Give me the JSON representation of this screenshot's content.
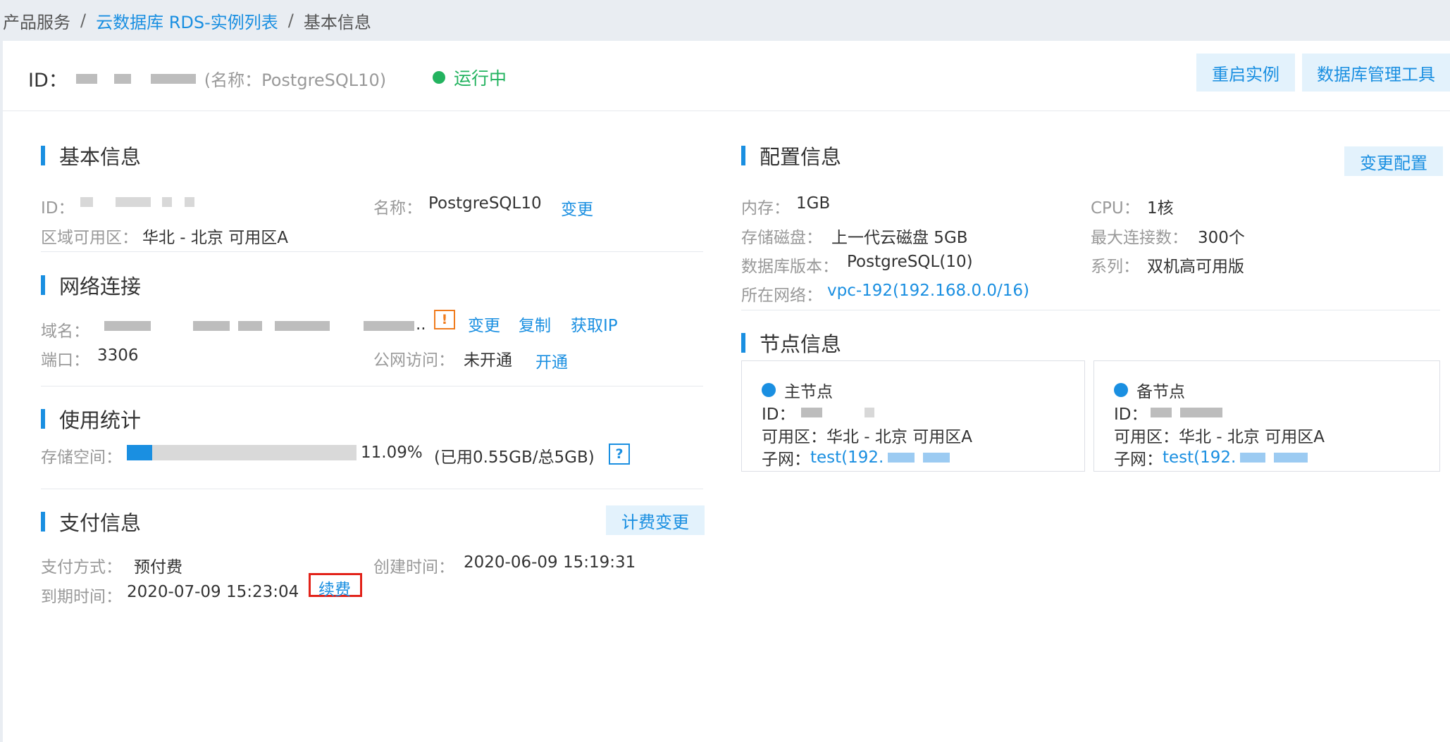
{
  "breadcrumb": {
    "items": [
      "产品服务",
      "云数据库 RDS-实例列表",
      "基本信息"
    ],
    "separator": "/"
  },
  "header": {
    "id_label": "ID：",
    "name_text": "(名称：PostgreSQL10)",
    "status_text": "运行中",
    "status_color": "#23b35f",
    "restart_button": "重启实例",
    "db_tool_button": "数据库管理工具"
  },
  "basic_info": {
    "title": "基本信息",
    "id_label": "ID：",
    "name_label": "名称：",
    "name_value": "PostgreSQL10",
    "change_link": "变更",
    "region_label": "区域可用区：",
    "region_value": "华北 - 北京 可用区A"
  },
  "network": {
    "title": "网络连接",
    "domain_label": "域名：",
    "domain_ellipsis": "..",
    "warn_icon": "!",
    "change_link": "变更",
    "copy_link": "复制",
    "get_ip_link": "获取IP",
    "port_label": "端口：",
    "port_value": "3306",
    "public_label": "公网访问：",
    "public_value": "未开通",
    "open_link": "开通"
  },
  "usage": {
    "title": "使用统计",
    "storage_label": "存储空间：",
    "percent_text": "11.09%",
    "percent_value": 0.1109,
    "detail_text": "(已用0.55GB/总5GB)",
    "help_icon": "?"
  },
  "payment": {
    "title": "支付信息",
    "billing_change_button": "计费变更",
    "method_label": "支付方式：",
    "method_value": "预付费",
    "created_label": "创建时间：",
    "created_value": "2020-06-09 15:19:31",
    "expire_label": "到期时间：",
    "expire_value": "2020-07-09 15:23:04",
    "renew_link": "续费"
  },
  "config": {
    "title": "配置信息",
    "change_button": "变更配置",
    "memory_label": "内存：",
    "memory_value": "1GB",
    "cpu_label": "CPU：",
    "cpu_value": "1核",
    "disk_label": "存储磁盘：",
    "disk_value": "上一代云磁盘 5GB",
    "maxconn_label": "最大连接数：",
    "maxconn_value": "300个",
    "version_label": "数据库版本：",
    "version_value": "PostgreSQL(10)",
    "series_label": "系列：",
    "series_value": "双机高可用版",
    "network_label": "所在网络：",
    "network_value": "vpc-192(192.168.0.0/16)"
  },
  "nodes": {
    "title": "节点信息",
    "master": {
      "name": "主节点",
      "id_label": "ID：",
      "zone_text": "可用区：华北 - 北京 可用区A",
      "subnet_label": "子网：",
      "subnet_value": "test(192."
    },
    "slave": {
      "name": "备节点",
      "id_label": "ID：",
      "zone_text": "可用区：华北 - 北京 可用区A",
      "subnet_label": "子网：",
      "subnet_value": "test(192."
    }
  },
  "colors": {
    "accent": "#1a8fe1",
    "running": "#23b35f",
    "warning": "#f07c1e",
    "highlight": "#e2231a"
  }
}
